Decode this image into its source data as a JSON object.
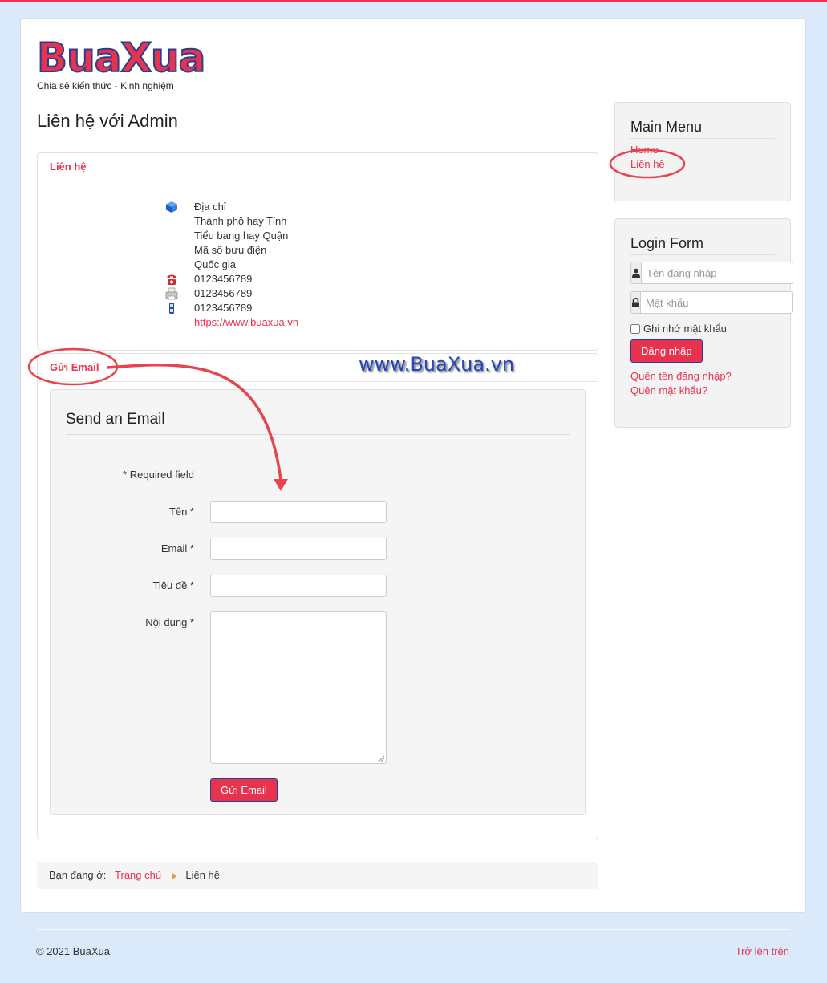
{
  "brand": {
    "logo_text": "BuaXua",
    "tagline": "Chia sẻ kiến thức - Kinh nghiệm"
  },
  "page": {
    "title": "Liên hệ với Admin"
  },
  "contact_panel": {
    "heading": "Liên hệ",
    "lines": [
      {
        "icon": "address-icon",
        "text": "Địa chỉ"
      },
      {
        "icon": "",
        "text": "Thành phố hay Tỉnh"
      },
      {
        "icon": "",
        "text": "Tiểu bang hay Quận"
      },
      {
        "icon": "",
        "text": "Mã số bưu điện"
      },
      {
        "icon": "",
        "text": "Quốc gia"
      },
      {
        "icon": "telephone-icon",
        "text": "0123456789"
      },
      {
        "icon": "fax-icon",
        "text": "0123456789"
      },
      {
        "icon": "mobile-phone-icon",
        "text": "0123456789"
      }
    ],
    "website": "https://www.buaxua.vn"
  },
  "email_panel": {
    "heading": "Gửi Email",
    "form_title": "Send an Email",
    "required_note": "* Required field",
    "fields": {
      "name_label": "Tên *",
      "email_label": "Email *",
      "subject_label": "Tiêu đề *",
      "message_label": "Nội dung *"
    },
    "submit_label": "Gửi Email"
  },
  "watermark": "www.BuaXua.vn",
  "breadcrumb": {
    "prefix": "Bạn đang ở:",
    "home": "Trang chủ",
    "current": "Liên hệ"
  },
  "main_menu": {
    "title": "Main Menu",
    "items": [
      "Home",
      "Liên hệ"
    ]
  },
  "login_form": {
    "title": "Login Form",
    "username_placeholder": "Tên đăng nhập",
    "password_placeholder": "Mật khẩu",
    "remember_label": "Ghi nhớ mật khẩu",
    "submit_label": "Đăng nhập",
    "forgot_username": "Quên tên đăng nhập?",
    "forgot_password": "Quên mật khẩu?"
  },
  "footer": {
    "copyright": "© 2021 BuaXua",
    "back_to_top": "Trở lên trên"
  },
  "colors": {
    "accent": "#e8334e",
    "page_bg": "#dbeafa",
    "logo_outline": "#2a3e8f",
    "annotation": "#e8444e"
  }
}
